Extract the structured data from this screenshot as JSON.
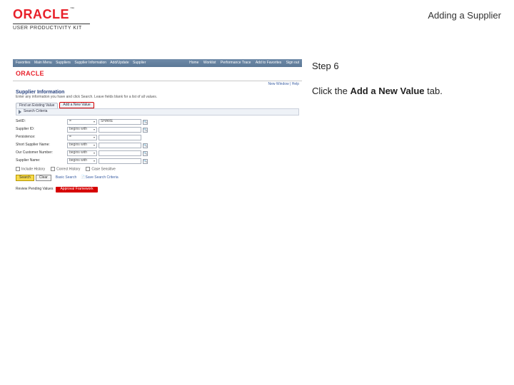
{
  "brand": {
    "logo": "ORACLE",
    "tm": "™",
    "subline": "USER PRODUCTIVITY KIT"
  },
  "doc_title": "Adding a Supplier",
  "instructions": {
    "step_label": "Step 6",
    "text_before": "Click the ",
    "text_bold": "Add a New Value",
    "text_after": " tab."
  },
  "screenshot": {
    "topbar": {
      "crumbs": [
        "Favorites",
        "Main Menu",
        "Suppliers",
        "Supplier Information",
        "Add/Update",
        "Supplier"
      ],
      "rightnav": [
        "Home",
        "Worklist",
        "Performance Trace",
        "Add to Favorites",
        "Sign out"
      ]
    },
    "mini_logo": "ORACLE",
    "new_window": "New Window | Help",
    "h1": "Supplier Information",
    "sub": "Enter any information you have and click Search. Leave fields blank for a list of all values.",
    "tabs": {
      "find": "Find an Existing Value",
      "add": "Add a New Value"
    },
    "search_bar": "Search Criteria",
    "fields": [
      {
        "label": "SetID:",
        "op": "=",
        "val": "SHARE",
        "lookup": true
      },
      {
        "label": "Supplier ID:",
        "op": "begins with",
        "val": "",
        "lookup": true
      },
      {
        "label": "Persistence:",
        "op": "=",
        "val": "",
        "lookup": false,
        "dropdown": true
      },
      {
        "label": "Short Supplier Name:",
        "op": "begins with",
        "val": "",
        "lookup": true
      },
      {
        "label": "Our Customer Number:",
        "op": "begins with",
        "val": "",
        "lookup": true
      },
      {
        "label": "Supplier Name:",
        "op": "begins with",
        "val": "",
        "lookup": true
      }
    ],
    "checks": [
      "Include History",
      "Correct History",
      "Case Sensitive"
    ],
    "buttons": {
      "search": "Search",
      "clear": "Clear",
      "basic": "Basic Search",
      "save": "Save Search Criteria"
    },
    "review": {
      "label": "Review Pending Values",
      "pill": "Approval Framework"
    }
  }
}
